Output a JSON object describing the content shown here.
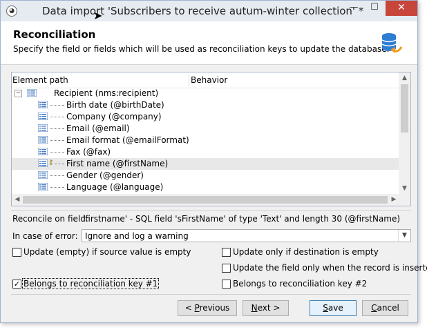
{
  "window": {
    "title": "Data import 'Subscribers to receive autum-winter collection' *",
    "minimize": "—",
    "maximize": "☐",
    "close": "✕"
  },
  "header": {
    "title": "Reconciliation",
    "subtitle": "Specify the field or fields which will be used as reconciliation keys to update the database."
  },
  "tree": {
    "col_element_path": "Element path",
    "col_behavior": "Behavior",
    "root": {
      "label": "Recipient (nms:recipient)",
      "expander": "−"
    },
    "items": [
      {
        "label": "Birth date (@birthDate)"
      },
      {
        "label": "Company (@company)"
      },
      {
        "label": "Email (@email)"
      },
      {
        "label": "Email format (@emailFormat)"
      },
      {
        "label": "Fax (@fax)"
      },
      {
        "label": "First name (@firstName)",
        "selected": true,
        "key": true
      },
      {
        "label": "Gender (@gender)"
      },
      {
        "label": "Language (@language)"
      }
    ]
  },
  "reconcile": {
    "label": "Reconcile on field:",
    "value": "'firstname' - SQL field 'sFirstName' of type 'Text' and length 30 (@firstName)"
  },
  "error": {
    "label": "In case of error:",
    "value": "Ignore and log a warning"
  },
  "options": {
    "update_empty": {
      "label": "Update (empty) if source value is empty",
      "checked": false
    },
    "update_only_dest_empty": {
      "label": "Update only if destination is empty",
      "checked": false
    },
    "update_on_insert": {
      "label": "Update the field only when the record is inserted",
      "checked": false
    },
    "key1": {
      "label": "Belongs to reconciliation key #1",
      "checked": true
    },
    "key2": {
      "label": "Belongs to reconciliation key #2",
      "checked": false
    }
  },
  "buttons": {
    "previous_pre": "< ",
    "previous_u": "P",
    "previous_post": "revious",
    "next_u": "N",
    "next_post": "ext >",
    "save_u": "S",
    "save_post": "ave",
    "cancel_u": "C",
    "cancel_post": "ancel"
  }
}
